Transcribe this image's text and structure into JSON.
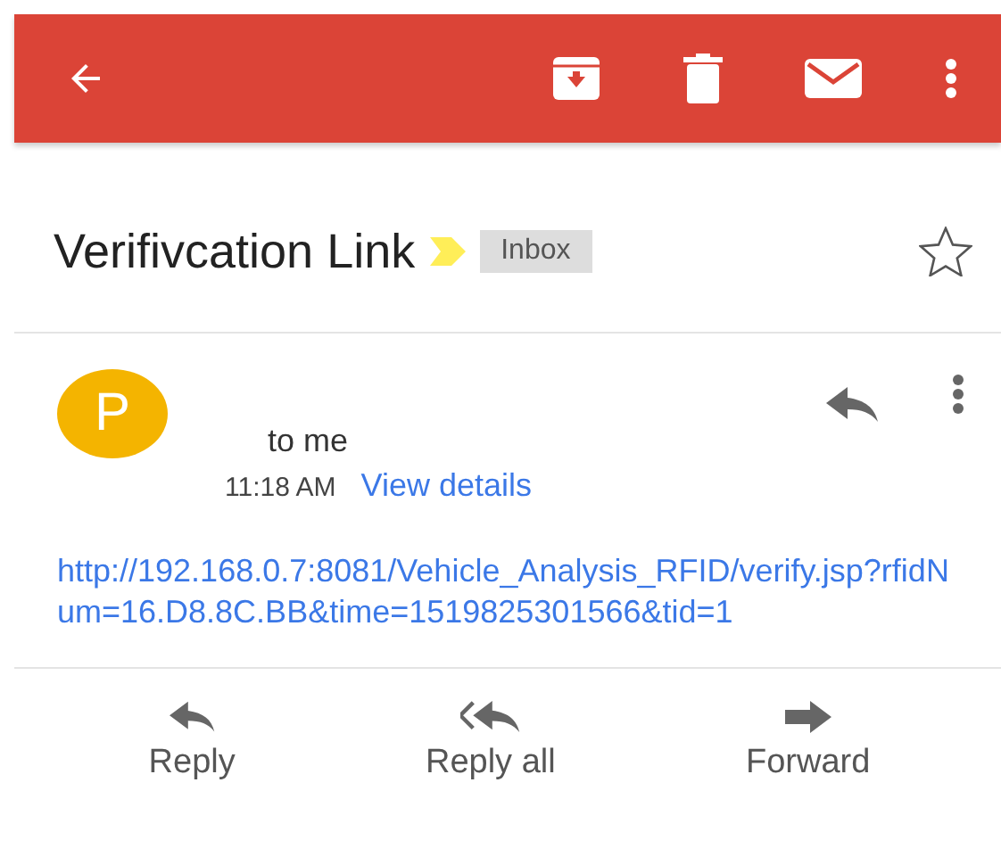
{
  "toolbar": {
    "actions": [
      {
        "kind": "archive"
      },
      {
        "kind": "delete"
      },
      {
        "kind": "mail"
      },
      {
        "kind": "more"
      }
    ]
  },
  "subject": {
    "title": "Verifivcation Link",
    "important": true,
    "label": "Inbox",
    "starred": false
  },
  "message": {
    "avatar_letter": "P",
    "recipient": "to me",
    "time": "11:18 AM",
    "details_link": "View details",
    "body_link": "http://192.168.0.7:8081/Vehicle_Analysis_RFID/verify.jsp?rfidNum=16.D8.8C.BB&time=1519825301566&tid=1"
  },
  "actions": [
    {
      "kind": "reply",
      "label": "Reply"
    },
    {
      "kind": "reply_all",
      "label": "Reply all"
    },
    {
      "kind": "forward",
      "label": "Forward"
    }
  ]
}
